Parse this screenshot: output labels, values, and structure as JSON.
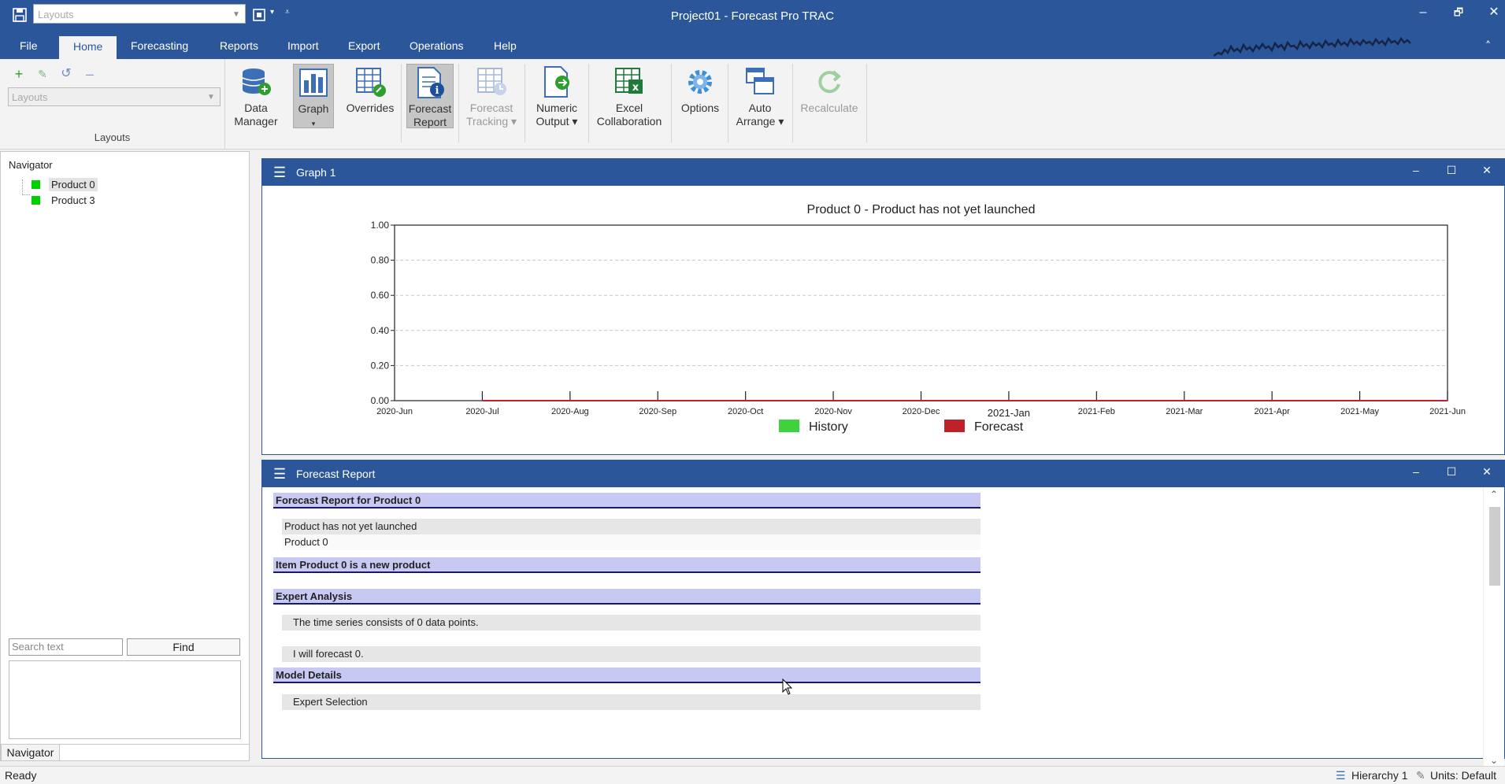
{
  "window": {
    "title": "Project01 - Forecast Pro TRAC",
    "qat_layout_placeholder": "Layouts",
    "minimize": "–",
    "restore": "🗗",
    "close": "✕",
    "collapse": "^"
  },
  "menu": {
    "items": [
      "File",
      "Home",
      "Forecasting",
      "Reports",
      "Import",
      "Export",
      "Operations",
      "Help"
    ],
    "active": "Home"
  },
  "ribbon": {
    "layouts_group": {
      "combo_placeholder": "Layouts",
      "label": "Layouts"
    },
    "buttons": [
      {
        "line1": "Data",
        "line2": "Manager",
        "icon": "data-manager-icon"
      },
      {
        "line1": "Graph",
        "line2": "▾",
        "icon": "graph-icon",
        "active": true
      },
      {
        "line1": "Overrides",
        "line2": "",
        "icon": "overrides-icon"
      },
      {
        "line1": "Forecast",
        "line2": "Report",
        "icon": "forecast-report-icon",
        "active": true
      },
      {
        "line1": "Forecast",
        "line2": "Tracking ▾",
        "icon": "forecast-tracking-icon",
        "disabled": true
      },
      {
        "line1": "Numeric",
        "line2": "Output ▾",
        "icon": "numeric-output-icon"
      },
      {
        "line1": "Excel",
        "line2": "Collaboration",
        "icon": "excel-collaboration-icon"
      },
      {
        "line1": "Options",
        "line2": "",
        "icon": "options-gear-icon"
      },
      {
        "line1": "Auto",
        "line2": "Arrange ▾",
        "icon": "auto-arrange-icon"
      },
      {
        "line1": "Recalculate",
        "line2": "",
        "icon": "recalculate-icon",
        "disabled": true
      }
    ]
  },
  "navigator": {
    "title": "Navigator",
    "items": [
      {
        "label": "Product 0",
        "color": "#00d000",
        "selected": true
      },
      {
        "label": "Product 3",
        "color": "#00d000",
        "selected": false
      }
    ],
    "search_placeholder": "Search text",
    "find_label": "Find",
    "tab_label": "Navigator"
  },
  "graph_panel": {
    "title": "Graph 1",
    "menu_icon": "☰",
    "minimize": "–",
    "maximize": "☐",
    "close": "✕"
  },
  "chart_data": {
    "type": "line",
    "title": "Product 0 - Product has not yet launched",
    "x": [
      "2020-Jun",
      "2020-Jul",
      "2020-Aug",
      "2020-Sep",
      "2020-Oct",
      "2020-Nov",
      "2020-Dec",
      "2021-Jan",
      "2021-Feb",
      "2021-Mar",
      "2021-Apr",
      "2021-May",
      "2021-Jun"
    ],
    "ylim": [
      0,
      1.0
    ],
    "yticks": [
      "1.00",
      "0.80",
      "0.60",
      "0.40",
      "0.20",
      "0.00"
    ],
    "grid": true,
    "legend_position": "bottom",
    "series": [
      {
        "name": "History",
        "color": "#3ed23e",
        "values": []
      },
      {
        "name": "Forecast",
        "color": "#c0202a",
        "values": [
          0,
          0,
          0,
          0,
          0,
          0,
          0,
          0,
          0,
          0,
          0,
          0
        ]
      }
    ]
  },
  "report_panel": {
    "title": "Forecast Report",
    "menu_icon": "☰",
    "minimize": "–",
    "maximize": "☐",
    "close": "✕",
    "rows": [
      {
        "kind": "head",
        "text": "Forecast Report for Product 0"
      },
      {
        "kind": "item",
        "text": "Product has not yet launched"
      },
      {
        "kind": "item white",
        "text": "Product 0"
      },
      {
        "kind": "head",
        "text": "Item Product 0 is a new product"
      },
      {
        "kind": "head",
        "text": "Expert Analysis"
      },
      {
        "kind": "item ind",
        "text": "The time series consists of 0 data points."
      },
      {
        "kind": "item ind",
        "text": "I will forecast 0."
      },
      {
        "kind": "head",
        "text": "Model Details"
      },
      {
        "kind": "item ind",
        "text": "Expert Selection"
      }
    ]
  },
  "statusbar": {
    "left": "Ready",
    "hierarchy": "Hierarchy 1",
    "units": "Units: Default"
  }
}
